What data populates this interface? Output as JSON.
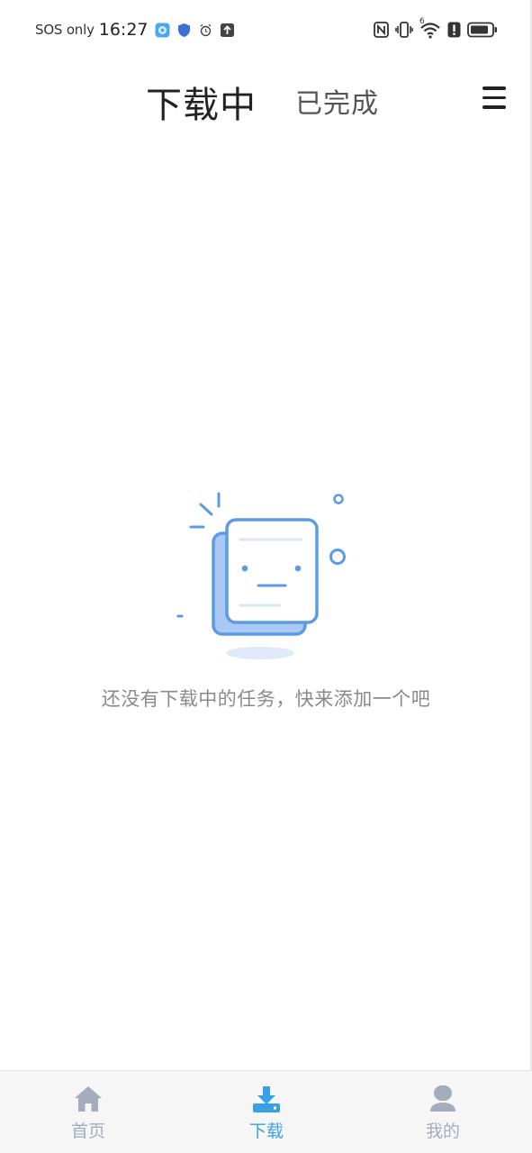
{
  "status_bar": {
    "carrier": "SOS only",
    "time": "16:27",
    "icons": [
      "app-gallery-icon",
      "shield-icon",
      "alarm-icon",
      "upload-icon",
      "nfc-icon",
      "vibrate-icon",
      "wifi-icon",
      "alert-icon",
      "battery-icon"
    ],
    "wifi_badge": "6"
  },
  "header": {
    "tabs": [
      {
        "label": "下载中",
        "active": true
      },
      {
        "label": "已完成",
        "active": false
      }
    ],
    "menu_icon": "menu-icon"
  },
  "empty_state": {
    "message": "还没有下载中的任务，快来添加一个吧",
    "illustration": "empty-document-icon",
    "accent_color": "#5b9be6"
  },
  "bottom_nav": {
    "items": [
      {
        "label": "首页",
        "icon": "home-icon",
        "active": false
      },
      {
        "label": "下载",
        "icon": "download-icon",
        "active": true
      },
      {
        "label": "我的",
        "icon": "user-icon",
        "active": false
      }
    ],
    "active_color": "#3aa0e6",
    "inactive_color": "#a3adbb"
  }
}
